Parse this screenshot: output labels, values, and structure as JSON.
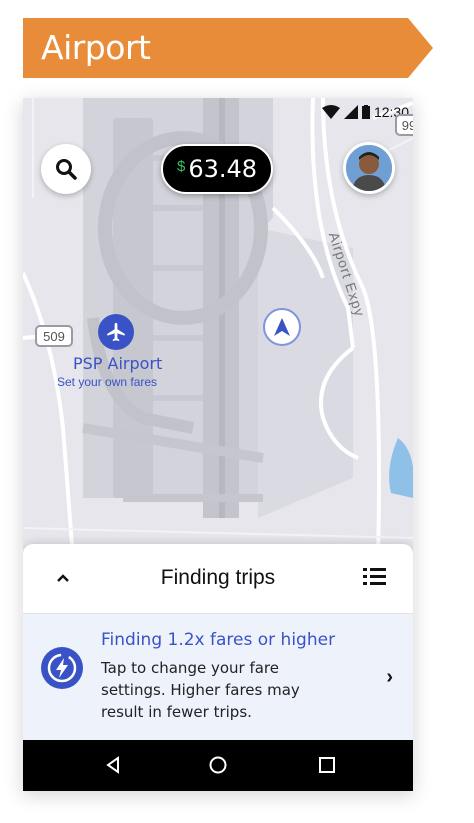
{
  "banner": {
    "label": "Airport",
    "color": "#e88c3a"
  },
  "status_bar": {
    "time": "12:30",
    "icons": [
      "wifi-icon",
      "signal-icon",
      "battery-icon"
    ]
  },
  "top_bar": {
    "search_icon": "search-icon",
    "earnings": {
      "currency": "$",
      "amount": "63.48"
    },
    "avatar": "driver-avatar"
  },
  "map": {
    "route_shields": [
      "509",
      "99"
    ],
    "airport": {
      "name": "PSP Airport",
      "subtitle": "Set your own fares",
      "icon": "airplane-icon"
    },
    "street_label": "Airport Expy",
    "current_location_icon": "navigation-arrow-icon",
    "accent": "#3953c6"
  },
  "sheet": {
    "title": "Finding trips",
    "expand_icon": "chevron-up-icon",
    "list_icon": "list-icon"
  },
  "fare_card": {
    "title": "Finding 1.2x fares or higher",
    "body": "Tap to change your fare settings. Higher fares may result in fewer trips.",
    "icon": "bolt-icon",
    "chevron": "›"
  },
  "android_nav": {
    "back": "back-icon",
    "home": "home-icon",
    "recents": "recents-icon"
  }
}
